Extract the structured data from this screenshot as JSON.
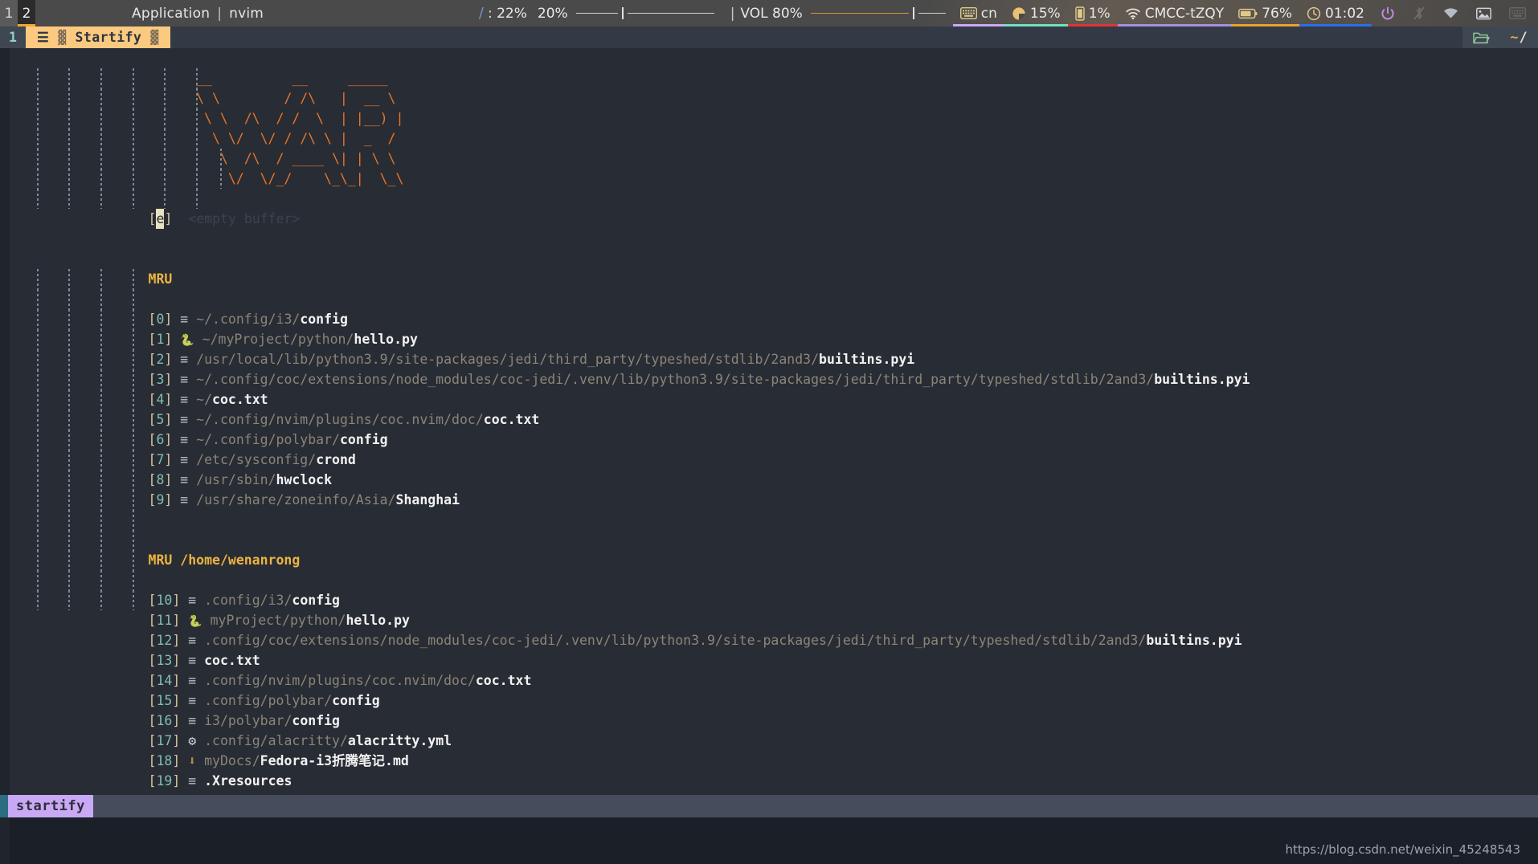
{
  "polybar": {
    "workspaces": [
      {
        "label": "1",
        "active": false
      },
      {
        "label": "2",
        "active": true
      }
    ],
    "window_title": "Application",
    "window_sep": "|",
    "window_name": "nvim",
    "brightness": {
      "icon": "brightness-icon",
      "icon_glyph": "",
      "label": ": 22%",
      "value": "20%"
    },
    "volume": {
      "sep": "|",
      "label": "VOL 80%"
    },
    "keyboard": {
      "icon": "keyboard-icon",
      "label": "cn",
      "underline": "#c9a8f5"
    },
    "cpu": {
      "icon": "pie-chart-icon",
      "label": "15%",
      "underline": "#6fe0c0"
    },
    "memory": {
      "icon": "memory-icon",
      "label": "1%",
      "underline": "#e03434"
    },
    "network": {
      "icon": "wifi-icon",
      "label": "CMCC-tZQY",
      "underline": "#a48fe0"
    },
    "battery": {
      "icon": "battery-icon",
      "label": "76%",
      "underline": "#e8a32a"
    },
    "clock": {
      "icon": "clock-icon",
      "label": "01:02",
      "underline": "#2a6fe8"
    },
    "power": {
      "icon": "power-icon"
    },
    "tray": [
      {
        "icon": "bluetooth-off-icon"
      },
      {
        "icon": "wifi-tray-icon"
      },
      {
        "icon": "screenshot-icon"
      },
      {
        "icon": "keyboard-tray-icon"
      }
    ]
  },
  "tabline": {
    "tab_number": "1",
    "list_icon": "☰",
    "checker_left": "▓",
    "tab_label": "Startify",
    "checker_right": "▓",
    "folder_icon": "folder-icon",
    "home_tilde": "~",
    "home_slash": "/"
  },
  "ascii_art": [
    "  __          __     _____  ",
    "  \\ \\        / /\\   |  __ \\ ",
    "   \\ \\  /\\  / /  \\  | |__) |",
    "    \\ \\/  \\/ / /\\ \\ |  _  / ",
    "     \\  /\\  / ____ \\| | \\ \\ ",
    "      \\/  \\/_/    \\_\\_|  \\_\\"
  ],
  "empty_buffer": {
    "index": "[e]",
    "cursor_char": "e",
    "label": "<empty buffer>"
  },
  "sections": [
    {
      "header": "MRU",
      "entries": [
        {
          "index": "0",
          "icon": "file-icon",
          "dir": "~/.config/i3/",
          "file": "config"
        },
        {
          "index": "1",
          "icon": "python-icon",
          "dir": "~/myProject/python/",
          "file": "hello.py"
        },
        {
          "index": "2",
          "icon": "file-icon",
          "dir": "/usr/local/lib/python3.9/site-packages/jedi/third_party/typeshed/stdlib/2and3/",
          "file": "builtins.pyi"
        },
        {
          "index": "3",
          "icon": "file-icon",
          "dir": "~/.config/coc/extensions/node_modules/coc-jedi/.venv/lib/python3.9/site-packages/jedi/third_party/typeshed/stdlib/2and3/",
          "file": "builtins.pyi"
        },
        {
          "index": "4",
          "icon": "file-icon",
          "dir": "~/",
          "file": "coc.txt"
        },
        {
          "index": "5",
          "icon": "file-icon",
          "dir": "~/.config/nvim/plugins/coc.nvim/doc/",
          "file": "coc.txt"
        },
        {
          "index": "6",
          "icon": "file-icon",
          "dir": "~/.config/polybar/",
          "file": "config"
        },
        {
          "index": "7",
          "icon": "file-icon",
          "dir": "/etc/sysconfig/",
          "file": "crond"
        },
        {
          "index": "8",
          "icon": "file-icon",
          "dir": "/usr/sbin/",
          "file": "hwclock"
        },
        {
          "index": "9",
          "icon": "file-icon",
          "dir": "/usr/share/zoneinfo/Asia/",
          "file": "Shanghai"
        }
      ]
    },
    {
      "header": "MRU /home/wenanrong",
      "entries": [
        {
          "index": "10",
          "icon": "file-icon",
          "dir": ".config/i3/",
          "file": "config"
        },
        {
          "index": "11",
          "icon": "python-icon",
          "dir": "myProject/python/",
          "file": "hello.py"
        },
        {
          "index": "12",
          "icon": "file-icon",
          "dir": ".config/coc/extensions/node_modules/coc-jedi/.venv/lib/python3.9/site-packages/jedi/third_party/typeshed/stdlib/2and3/",
          "file": "builtins.pyi"
        },
        {
          "index": "13",
          "icon": "file-icon",
          "dir": "",
          "file": "coc.txt"
        },
        {
          "index": "14",
          "icon": "file-icon",
          "dir": ".config/nvim/plugins/coc.nvim/doc/",
          "file": "coc.txt"
        },
        {
          "index": "15",
          "icon": "file-icon",
          "dir": ".config/polybar/",
          "file": "config"
        },
        {
          "index": "16",
          "icon": "file-icon",
          "dir": "i3/polybar/",
          "file": "config"
        },
        {
          "index": "17",
          "icon": "gear-icon",
          "dir": ".config/alacritty/",
          "file": "alacritty.yml"
        },
        {
          "index": "18",
          "icon": "markdown-icon",
          "dir": "myDocs/",
          "file": "Fedora-i3折腾笔记.md"
        },
        {
          "index": "19",
          "icon": "file-icon",
          "dir": "",
          "file": ".Xresources"
        }
      ]
    }
  ],
  "statusline": {
    "mode": "startify"
  },
  "watermark": "https://blog.csdn.net/weixin_45248543",
  "colors": {
    "bg": "#282c34",
    "tabline_bg": "#343a45",
    "tab_active_bg": "#fbc97f",
    "art": "#e8752a",
    "header": "#ecb441",
    "index_number": "#7fbfb0",
    "index_bracket": "#d7c9a0",
    "path_dim": "#8b8578",
    "filename": "#f2f2f2",
    "statusline_mode_bg": "#c9a8f5"
  }
}
